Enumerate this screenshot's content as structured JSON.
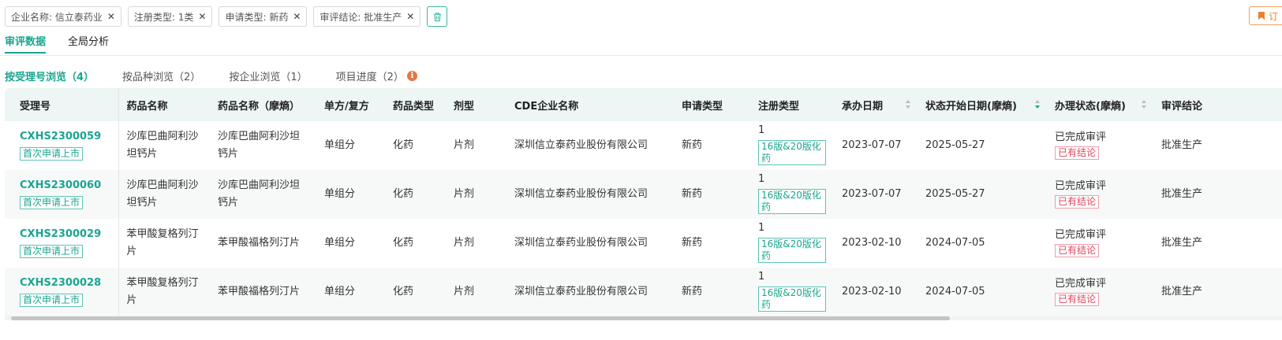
{
  "filters": [
    {
      "label": "企业名称: 信立泰药业"
    },
    {
      "label": "注册类型: 1类"
    },
    {
      "label": "申请类型: 新药"
    },
    {
      "label": "审评结论: 批准生产"
    }
  ],
  "filter_remove_glyph": "✕",
  "subscribe_label": "订",
  "main_tabs": [
    {
      "label": "审评数据",
      "active": true
    },
    {
      "label": "全局分析",
      "active": false
    }
  ],
  "sub_tabs": [
    {
      "label": "按受理号浏览（4）",
      "active": true
    },
    {
      "label": "按品种浏览（2）",
      "active": false
    },
    {
      "label": "按企业浏览（1）",
      "active": false
    },
    {
      "label": "项目进度（2）",
      "active": false
    }
  ],
  "info_icon_glyph": "i",
  "columns": {
    "accept_no": "受理号",
    "drug_name": "药品名称",
    "drug_name_summary": "药品名称（摩熵）",
    "single_compound": "单方/复方",
    "drug_type": "药品类型",
    "dosage_form": "剂型",
    "cde_company": "CDE企业名称",
    "apply_type": "申请类型",
    "reg_type": "注册类型",
    "undertake_date": "承办日期",
    "status_start_date": "状态开始日期(摩熵)",
    "handling_status": "办理状态(摩熵)",
    "review_conclusion": "审评结论"
  },
  "rows": [
    {
      "accept_no": "CXHS2300059",
      "apply_tag": "首次申请上市",
      "drug_name": "沙库巴曲阿利沙坦钙片",
      "drug_name_summary": "沙库巴曲阿利沙坦钙片",
      "single_compound": "单组分",
      "drug_type": "化药",
      "dosage_form": "片剂",
      "cde_company": "深圳信立泰药业股份有限公司",
      "apply_type": "新药",
      "reg_type": "1",
      "reg_tag": "16版&20版化药",
      "undertake_date": "2023-07-07",
      "status_start_date": "2025-05-27",
      "handling_status": "已完成审评",
      "status_tag": "已有结论",
      "review_conclusion": "批准生产"
    },
    {
      "accept_no": "CXHS2300060",
      "apply_tag": "首次申请上市",
      "drug_name": "沙库巴曲阿利沙坦钙片",
      "drug_name_summary": "沙库巴曲阿利沙坦钙片",
      "single_compound": "单组分",
      "drug_type": "化药",
      "dosage_form": "片剂",
      "cde_company": "深圳信立泰药业股份有限公司",
      "apply_type": "新药",
      "reg_type": "1",
      "reg_tag": "16版&20版化药",
      "undertake_date": "2023-07-07",
      "status_start_date": "2025-05-27",
      "handling_status": "已完成审评",
      "status_tag": "已有结论",
      "review_conclusion": "批准生产"
    },
    {
      "accept_no": "CXHS2300029",
      "apply_tag": "首次申请上市",
      "drug_name": "苯甲酸复格列汀片",
      "drug_name_summary": "苯甲酸福格列汀片",
      "single_compound": "单组分",
      "drug_type": "化药",
      "dosage_form": "片剂",
      "cde_company": "深圳信立泰药业股份有限公司",
      "apply_type": "新药",
      "reg_type": "1",
      "reg_tag": "16版&20版化药",
      "undertake_date": "2023-02-10",
      "status_start_date": "2024-07-05",
      "handling_status": "已完成审评",
      "status_tag": "已有结论",
      "review_conclusion": "批准生产"
    },
    {
      "accept_no": "CXHS2300028",
      "apply_tag": "首次申请上市",
      "drug_name": "苯甲酸复格列汀片",
      "drug_name_summary": "苯甲酸福格列汀片",
      "single_compound": "单组分",
      "drug_type": "化药",
      "dosage_form": "片剂",
      "cde_company": "深圳信立泰药业股份有限公司",
      "apply_type": "新药",
      "reg_type": "1",
      "reg_tag": "16版&20版化药",
      "undertake_date": "2023-02-10",
      "status_start_date": "2024-07-05",
      "handling_status": "已完成审评",
      "status_tag": "已有结论",
      "review_conclusion": "批准生产"
    }
  ],
  "scroll_position_fraction": 0.0,
  "colors": {
    "accent": "#1aa58f",
    "header_bg": "#edf5f5",
    "danger_tag": "#e0435d",
    "subscribe_orange": "#e8812e",
    "info_icon": "#e07846"
  }
}
